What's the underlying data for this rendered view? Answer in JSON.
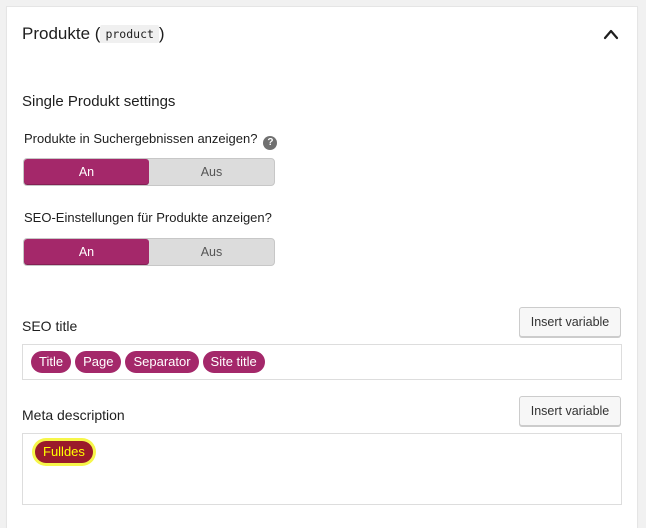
{
  "section": {
    "title": "Produkte",
    "paren_open": "(",
    "code": "product",
    "paren_close": ")"
  },
  "settings_heading": "Single Produkt settings",
  "questions": [
    {
      "label": "Produkte in Suchergebnissen anzeigen?",
      "help": "?",
      "on": "An",
      "off": "Aus",
      "selected": "An"
    },
    {
      "label": "SEO-Einstellungen für Produkte anzeigen?",
      "on": "An",
      "off": "Aus",
      "selected": "An"
    }
  ],
  "seo_title": {
    "label": "SEO title",
    "insert_label": "Insert variable",
    "variables": [
      "Title",
      "Page",
      "Separator",
      "Site title"
    ]
  },
  "meta_description": {
    "label": "Meta description",
    "insert_label": "Insert variable",
    "variables": [
      "Fulldes"
    ]
  },
  "colors": {
    "accent": "#a4286a",
    "highlight": "#ffff00"
  }
}
